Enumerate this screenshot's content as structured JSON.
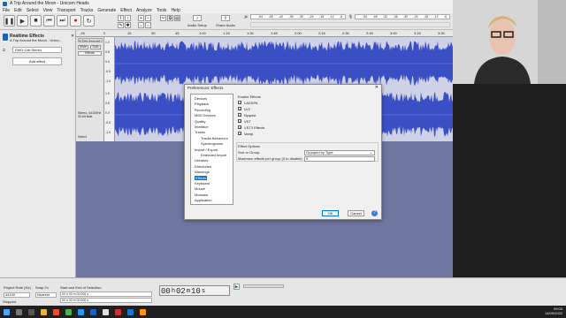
{
  "titlebar": {
    "title": "A Trip Around the Moon - Unicorn Heads",
    "min": "—",
    "max": "☐",
    "close": "✕"
  },
  "menu": [
    "File",
    "Edit",
    "Select",
    "View",
    "Transport",
    "Tracks",
    "Generate",
    "Effect",
    "Analyze",
    "Tools",
    "Help"
  ],
  "toolbar": {
    "audio_setup": "Audio Setup",
    "share_audio": "Share Audio",
    "meter_ticks": [
      "-54",
      "-48",
      "-42",
      "-36",
      "-30",
      "-24",
      "-18",
      "-12",
      "-6"
    ],
    "rec_meter_ticks": [
      "-54",
      "-48",
      "-42",
      "-36",
      "-30",
      "-24",
      "-18",
      "-12",
      "-6"
    ]
  },
  "ruler": {
    "ticks": [
      "-15",
      "0",
      "15",
      "30",
      "45",
      "1:00",
      "1:15",
      "1:30",
      "1:45",
      "2:00",
      "2:15",
      "2:30",
      "2:45",
      "3:00",
      "3:15",
      "3:30"
    ]
  },
  "sidebar": {
    "title": "Realtime Effects",
    "subtitle": "A Trip Around the Moon - Unico...",
    "preset": "EMO-Cali Stereo",
    "add_effect": "Add effect"
  },
  "track": {
    "name": "A Trip Around",
    "mute": "Mute",
    "solo": "Solo",
    "effects": "Effects",
    "info1": "Stereo, 44100Hz",
    "info2": "32-bit float",
    "select": "Select",
    "scale": [
      "1.0",
      "0.5",
      "0.0",
      "-0.5",
      "-1.0",
      "1.0",
      "0.5",
      "0.0",
      "-0.5",
      "-1.0"
    ],
    "waveform_color": "#3b4fc4"
  },
  "dialog": {
    "title": "Preferences: Effects",
    "close": "✕",
    "tree": [
      {
        "label": "Devices",
        "indent": 0,
        "selected": false
      },
      {
        "label": "Playback",
        "indent": 0,
        "selected": false
      },
      {
        "label": "Recording",
        "indent": 0,
        "selected": false
      },
      {
        "label": "MIDI Devices",
        "indent": 0,
        "selected": false
      },
      {
        "label": "Quality",
        "indent": 0,
        "selected": false
      },
      {
        "label": "Interface",
        "indent": 0,
        "selected": false
      },
      {
        "label": "Tracks",
        "indent": 0,
        "selected": false
      },
      {
        "label": "Tracks Behaviors",
        "indent": 1,
        "selected": false
      },
      {
        "label": "Spectrograms",
        "indent": 1,
        "selected": false
      },
      {
        "label": "Import / Export",
        "indent": 0,
        "selected": false
      },
      {
        "label": "Extended Import",
        "indent": 1,
        "selected": false
      },
      {
        "label": "Libraries",
        "indent": 0,
        "selected": false
      },
      {
        "label": "Directories",
        "indent": 0,
        "selected": false
      },
      {
        "label": "Warnings",
        "indent": 0,
        "selected": false
      },
      {
        "label": "Effects",
        "indent": 0,
        "selected": true
      },
      {
        "label": "Keyboard",
        "indent": 0,
        "selected": false
      },
      {
        "label": "Mouse",
        "indent": 0,
        "selected": false
      },
      {
        "label": "Modules",
        "indent": 0,
        "selected": false
      },
      {
        "label": "Application",
        "indent": 0,
        "selected": false
      }
    ],
    "enable_heading": "Enable Effects",
    "effects": [
      {
        "label": "LADSPA",
        "checked": true
      },
      {
        "label": "LV2",
        "checked": true
      },
      {
        "label": "Nyquist",
        "checked": true
      },
      {
        "label": "VST",
        "checked": true
      },
      {
        "label": "VST3 Effects",
        "checked": true
      },
      {
        "label": "Vamp",
        "checked": true
      }
    ],
    "options_heading": "Effect Options",
    "sort_label": "Sort or Group:",
    "sort_value": "Grouped by Type",
    "max_label": "Maximum effects per group (0 to disable):",
    "max_value": "0",
    "ok": "OK",
    "cancel": "Cancel",
    "help": "?"
  },
  "bottom": {
    "project_rate_label": "Project Rate (Hz)",
    "project_rate": "44100",
    "snap_label": "Snap-To",
    "snap": "Nearest",
    "selection_label": "Start and End of Selection",
    "sel_start": "00 h 00 m 00.000 s",
    "sel_end": "00 h 00 m 00.000 s",
    "time": [
      "00",
      "h",
      "02",
      "m",
      "10",
      "s"
    ],
    "status": "Stopped."
  },
  "tray": {
    "time": "09:03",
    "date": "14/09/2022"
  }
}
